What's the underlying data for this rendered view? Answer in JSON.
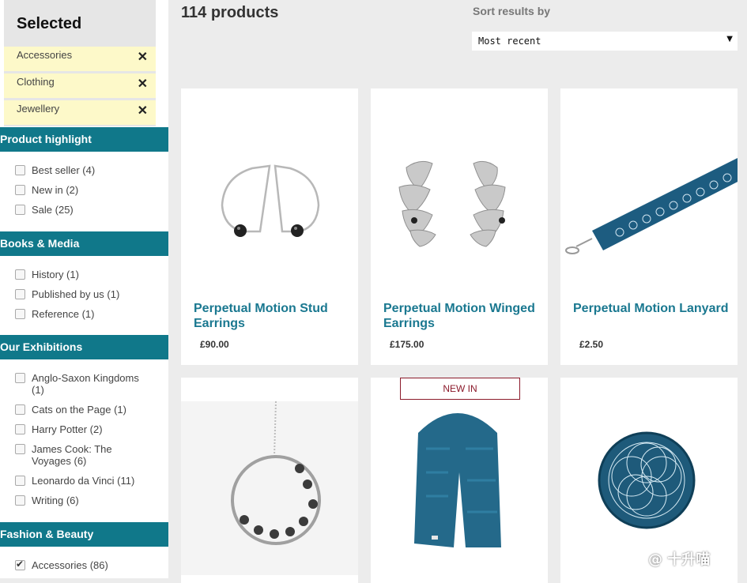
{
  "selected": {
    "title": "Selected",
    "items": [
      "Accessories",
      "Clothing",
      "Jewellery"
    ]
  },
  "categories": [
    {
      "title": "Product highlight",
      "filters": [
        {
          "label": "Best seller (4)",
          "checked": false
        },
        {
          "label": "New in (2)",
          "checked": false
        },
        {
          "label": "Sale (25)",
          "checked": false
        }
      ]
    },
    {
      "title": "Books & Media",
      "filters": [
        {
          "label": "History (1)",
          "checked": false
        },
        {
          "label": "Published by us (1)",
          "checked": false
        },
        {
          "label": "Reference (1)",
          "checked": false
        }
      ]
    },
    {
      "title": "Our Exhibitions",
      "filters": [
        {
          "label": "Anglo-Saxon Kingdoms (1)",
          "checked": false
        },
        {
          "label": "Cats on the Page (1)",
          "checked": false
        },
        {
          "label": "Harry Potter (2)",
          "checked": false
        },
        {
          "label": "James Cook: The Voyages (6)",
          "checked": false
        },
        {
          "label": "Leonardo da Vinci (11)",
          "checked": false
        },
        {
          "label": "Writing (6)",
          "checked": false
        }
      ]
    },
    {
      "title": "Fashion & Beauty",
      "filters": [
        {
          "label": "Accessories (86)",
          "checked": true
        }
      ]
    }
  ],
  "results": {
    "count": "114 products",
    "sort_label": "Sort results by",
    "sort_value": "Most recent"
  },
  "products": [
    {
      "name": "Perpetual Motion Stud Earrings",
      "price": "£90.00",
      "icon": "stud-earrings-image"
    },
    {
      "name": "Perpetual Motion Winged Earrings",
      "price": "£175.00",
      "icon": "winged-earrings-image"
    },
    {
      "name": "Perpetual Motion Lanyard",
      "price": "£2.50",
      "icon": "lanyard-image"
    },
    {
      "name": "",
      "price": "",
      "icon": "pendant-necklace-image"
    },
    {
      "name": "",
      "price": "",
      "icon": "scarf-image",
      "badge": "NEW IN"
    },
    {
      "name": "",
      "price": "",
      "icon": "round-coaster-image"
    }
  ],
  "watermark": "@ 十升喵",
  "colors": {
    "header": "#10788a",
    "product_name": "#1a7890",
    "selected_bg": "#fdf9c9",
    "badge": "#8b1a2b"
  }
}
